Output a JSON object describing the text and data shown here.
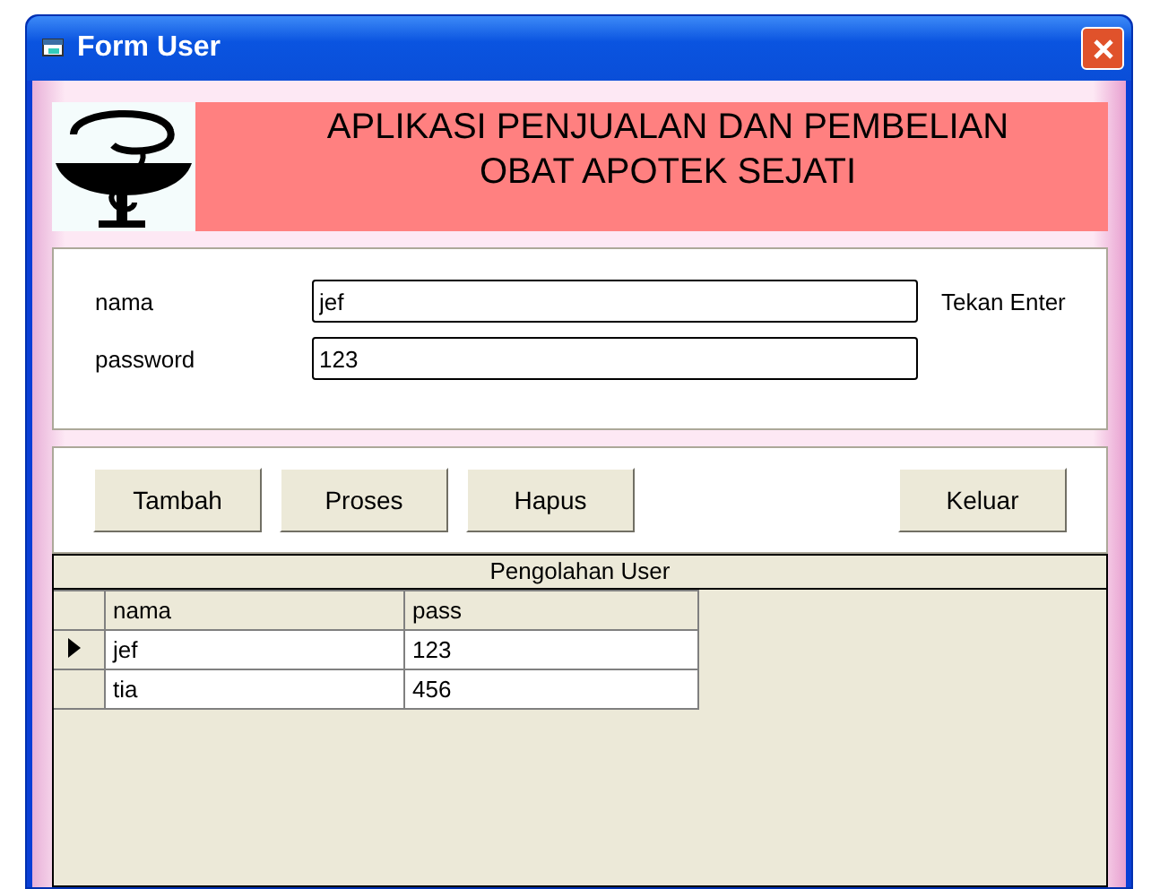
{
  "window": {
    "title": "Form User"
  },
  "banner": {
    "line1": "APLIKASI PENJUALAN DAN PEMBELIAN",
    "line2": "OBAT APOTEK SEJATI"
  },
  "fields": [
    {
      "label": "nama",
      "value": "jef",
      "hint": "Tekan Enter"
    },
    {
      "label": "password",
      "value": "123"
    }
  ],
  "buttons": [
    {
      "label": "Tambah"
    },
    {
      "label": "Proses"
    },
    {
      "label": "Hapus"
    },
    {
      "label": "Keluar"
    }
  ],
  "table": {
    "caption": "Pengolahan User",
    "columns": [
      "nama",
      "pass"
    ],
    "rows": [
      {
        "cells": [
          "jef",
          "123"
        ],
        "selected": true
      },
      {
        "cells": [
          "tia",
          "456"
        ],
        "selected": false
      }
    ]
  }
}
